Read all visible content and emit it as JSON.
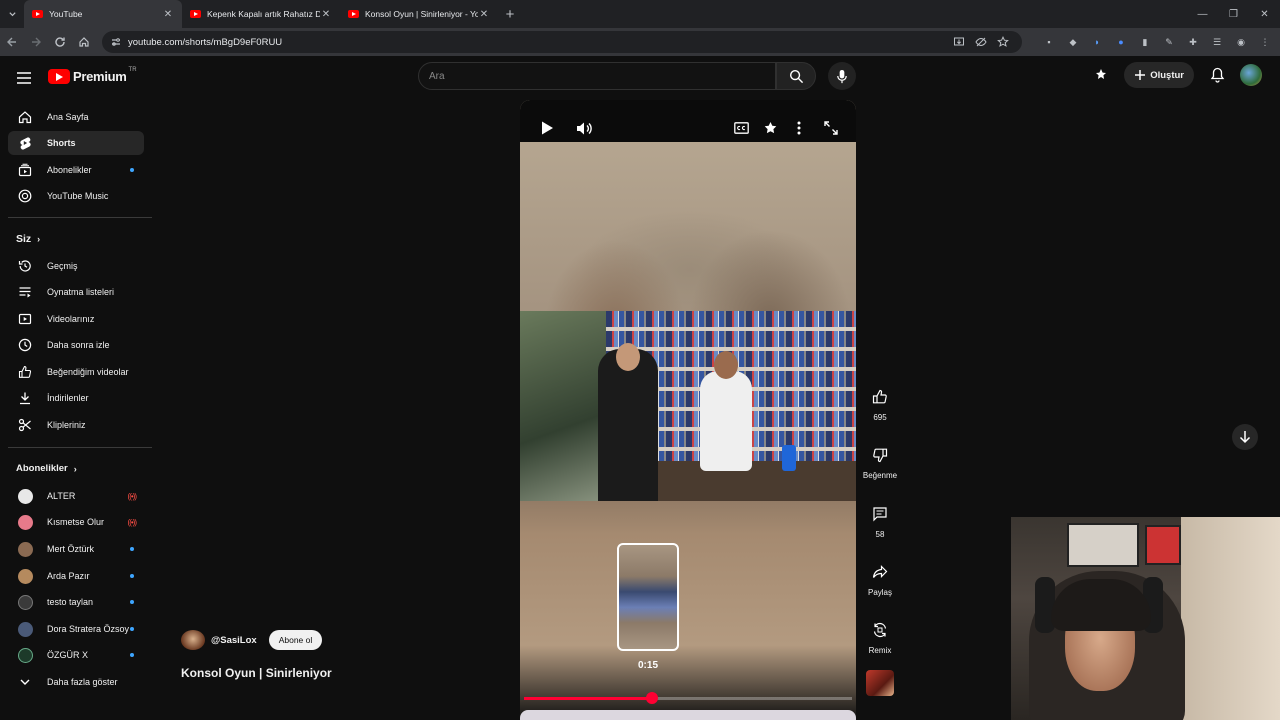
{
  "browser": {
    "tabs": [
      {
        "title": "YouTube",
        "active": true
      },
      {
        "title": "Kepenk Kapalı artık Rahatız De",
        "active": false
      },
      {
        "title": "Konsol Oyun | Sinirleniyor - Yo",
        "active": false
      }
    ],
    "url": "youtube.com/shorts/mBgD9eF0RUU"
  },
  "header": {
    "logo_text": "Premium",
    "logo_country": "TR",
    "search_placeholder": "Ara",
    "create_label": "Oluştur"
  },
  "sidebar": {
    "main": [
      {
        "label": "Ana Sayfa",
        "icon": "home-icon"
      },
      {
        "label": "Shorts",
        "icon": "shorts-icon",
        "selected": true
      },
      {
        "label": "Abonelikler",
        "icon": "subscriptions-icon",
        "dot": true
      },
      {
        "label": "YouTube Music",
        "icon": "music-icon"
      }
    ],
    "you_heading": "Siz",
    "you": [
      {
        "label": "Geçmiş",
        "icon": "history-icon"
      },
      {
        "label": "Oynatma listeleri",
        "icon": "playlists-icon"
      },
      {
        "label": "Videolarınız",
        "icon": "your-videos-icon"
      },
      {
        "label": "Daha sonra izle",
        "icon": "watch-later-icon"
      },
      {
        "label": "Beğendiğim videolar",
        "icon": "liked-icon"
      },
      {
        "label": "İndirilenler",
        "icon": "downloads-icon"
      },
      {
        "label": "Klipleriniz",
        "icon": "clips-icon"
      }
    ],
    "subs_heading": "Abonelikler",
    "subs": [
      {
        "label": "ALTER",
        "indicator": "live",
        "color": "#e8e8e8"
      },
      {
        "label": "Kısmetse Olur",
        "indicator": "live",
        "color": "#e77a8a"
      },
      {
        "label": "Mert Öztürk",
        "indicator": "dot",
        "color": "#8a6a52"
      },
      {
        "label": "Arda Pazır",
        "indicator": "dot",
        "color": "#b58a5e"
      },
      {
        "label": "testo taylan",
        "indicator": "dot",
        "color": "#3a3a3a"
      },
      {
        "label": "Dora Stratera Özsoy",
        "indicator": "dot",
        "color": "#4a5a78"
      },
      {
        "label": "ÖZGÜR X",
        "indicator": "dot",
        "color": "#1d3a2a"
      }
    ],
    "show_more": "Daha fazla göster"
  },
  "player": {
    "hover_time": "0:15",
    "progress": 0.39
  },
  "actions": {
    "like_count": "695",
    "dislike_label": "Beğenme",
    "comment_count": "58",
    "share_label": "Paylaş",
    "remix_label": "Remix"
  },
  "video": {
    "channel": "@SasiLox",
    "subscribe_label": "Abone ol",
    "title": "Konsol Oyun | Sinirleniyor"
  },
  "colors": {
    "accent": "#ff0033",
    "background": "#0f0f0f",
    "notification_dot": "#3ea6ff"
  }
}
